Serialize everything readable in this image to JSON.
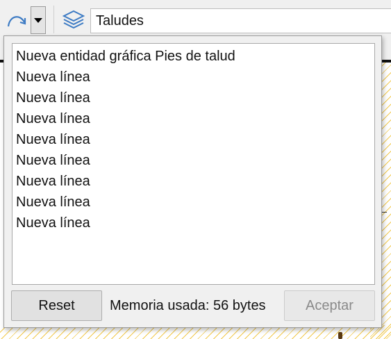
{
  "toolbar": {
    "line_tool_icon": "curve-arrow-icon",
    "dropdown_icon": "triangle-down-icon",
    "layers_icon": "layers-icon",
    "current_layer": "Taludes"
  },
  "popup": {
    "log_items": [
      "Nueva entidad gráfica Pies de talud",
      "Nueva línea",
      "Nueva línea",
      "Nueva línea",
      "Nueva línea",
      "Nueva línea",
      "Nueva línea",
      "Nueva línea",
      "Nueva línea"
    ],
    "reset_label": "Reset",
    "memory_text": "Memoria usada: 56 bytes",
    "accept_label": "Aceptar",
    "accept_enabled": false
  },
  "colors": {
    "icon_blue": "#3d7bc4",
    "hatch_yellow": "#f2c94c",
    "disabled_text": "#8a8a8a"
  }
}
